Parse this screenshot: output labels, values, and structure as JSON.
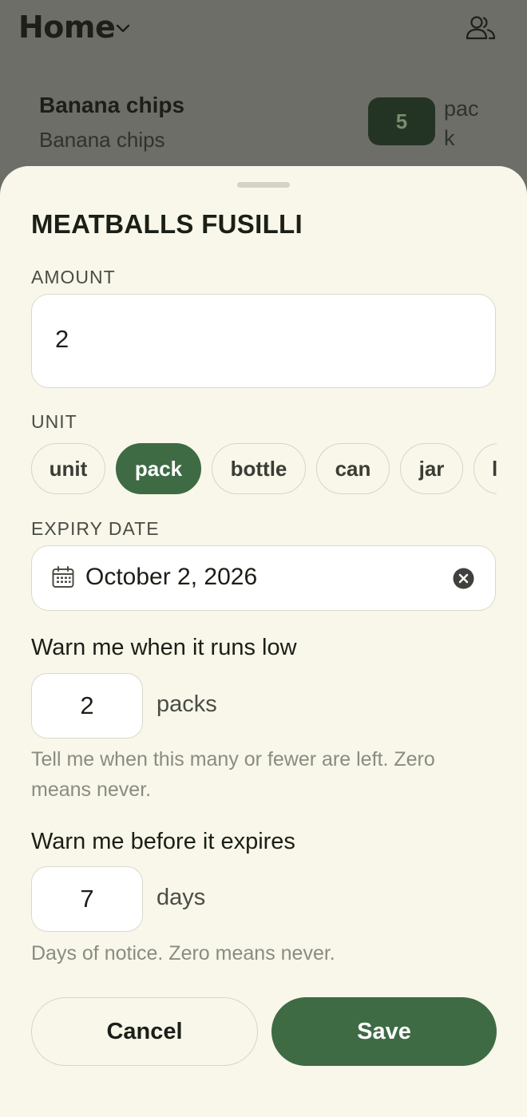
{
  "header": {
    "title": "Home"
  },
  "background_item": {
    "name": "Banana chips",
    "subtitle": "Banana chips",
    "count": "5",
    "unit": "pack"
  },
  "sheet": {
    "title": "MEATBALLS FUSILLI",
    "amount": {
      "label": "AMOUNT",
      "value": "2"
    },
    "unit": {
      "label": "UNIT",
      "options": [
        "unit",
        "pack",
        "bottle",
        "can",
        "jar",
        "l"
      ],
      "selected": "pack"
    },
    "expiry": {
      "label": "EXPIRY DATE",
      "value": "October 2, 2026"
    },
    "low_stock": {
      "question": "Warn me when it runs low",
      "value": "2",
      "unit": "packs",
      "hint": "Tell me when this many or fewer are left. Zero means never."
    },
    "expiry_warning": {
      "question": "Warn me before it expires",
      "value": "7",
      "unit": "days",
      "hint": "Days of notice. Zero means never."
    },
    "buttons": {
      "cancel": "Cancel",
      "save": "Save"
    }
  },
  "colors": {
    "accent": "#3e6b44",
    "sheet_background": "#f8f7ea",
    "scrim": "#6e6e68"
  }
}
